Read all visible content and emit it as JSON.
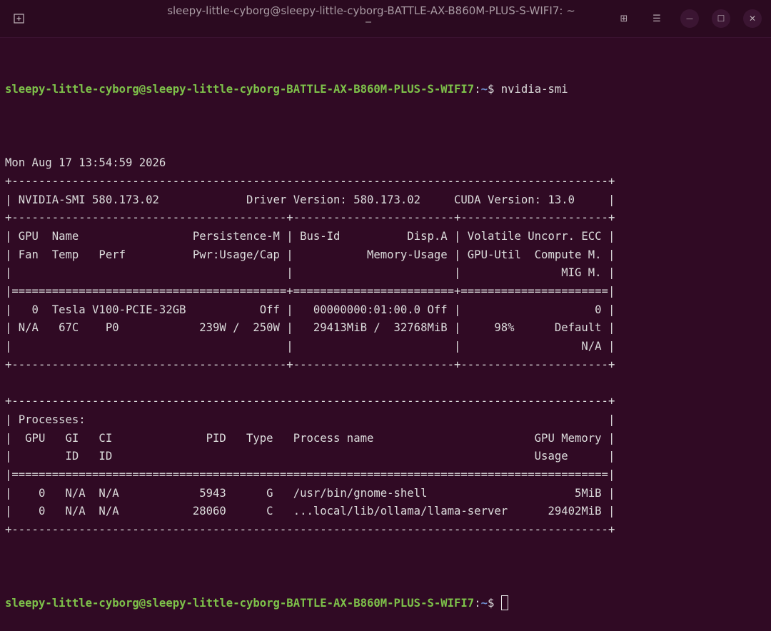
{
  "window": {
    "title": "sleepy-little-cyborg@sleepy-little-cyborg-BATTLE-AX-B860M-PLUS-S-WIFI7: ~",
    "icons": [
      "new-tab-icon",
      "grid-icon",
      "menu-icon",
      "minimize-icon",
      "maximize-icon",
      "close-icon"
    ],
    "minimize_glyph": "—",
    "maximize_glyph": "☐",
    "close_glyph": "✕",
    "grid_glyph": "⊞",
    "menu_glyph": "☰"
  },
  "prompt": {
    "user_host": "sleepy-little-cyborg@sleepy-little-cyborg-BATTLE-AX-B860M-PLUS-S-WIFI7",
    "separator": ":",
    "path": "~",
    "symbol": "$ ",
    "command": "nvidia-smi"
  },
  "output": {
    "lines": [
      "Mon Aug 17 13:54:59 2026",
      "+-----------------------------------------------------------------------------------------+",
      "| NVIDIA-SMI 580.173.02             Driver Version: 580.173.02     CUDA Version: 13.0     |",
      "+-----------------------------------------+------------------------+----------------------+",
      "| GPU  Name                 Persistence-M | Bus-Id          Disp.A | Volatile Uncorr. ECC |",
      "| Fan  Temp   Perf          Pwr:Usage/Cap |           Memory-Usage | GPU-Util  Compute M. |",
      "|                                         |                        |               MIG M. |",
      "|=========================================+========================+======================|",
      "|   0  Tesla V100-PCIE-32GB           Off |   00000000:01:00.0 Off |                    0 |",
      "| N/A   67C    P0            239W /  250W |   29413MiB /  32768MiB |     98%      Default |",
      "|                                         |                        |                  N/A |",
      "+-----------------------------------------+------------------------+----------------------+",
      "",
      "+-----------------------------------------------------------------------------------------+",
      "| Processes:                                                                              |",
      "|  GPU   GI   CI              PID   Type   Process name                        GPU Memory |",
      "|        ID   ID                                                               Usage      |",
      "|=========================================================================================|",
      "|    0   N/A  N/A            5943      G   /usr/bin/gnome-shell                      5MiB |",
      "|    0   N/A  N/A           28060      C   ...local/lib/ollama/llama-server      29402MiB |",
      "+-----------------------------------------------------------------------------------------+"
    ]
  },
  "final_prompt": {
    "user_host": "sleepy-little-cyborg@sleepy-little-cyborg-BATTLE-AX-B860M-PLUS-S-WIFI7",
    "separator": ":",
    "path": "~",
    "symbol": "$ "
  },
  "colors": {
    "background": "#300a24",
    "prompt_user": "#7ec24a",
    "prompt_path": "#6f8fd0",
    "text": "#dcdcdc"
  }
}
